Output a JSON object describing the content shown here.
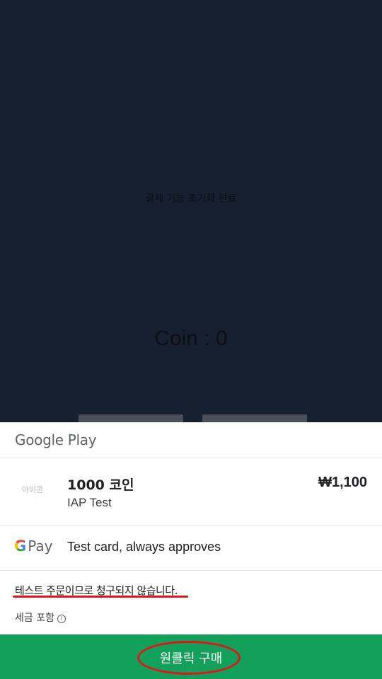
{
  "app": {
    "status_text": "결제 기능 초기화 완료",
    "coin_text": "Coin : 0"
  },
  "sheet": {
    "header": {
      "title": "Google Play"
    },
    "item": {
      "icon_placeholder": "아이콘",
      "title": "1000 코인",
      "subtitle": "IAP Test",
      "price": "₩1,100"
    },
    "payment": {
      "logo_g": "G",
      "logo_pay": "Pay",
      "method": "Test card, always approves"
    },
    "notice": "테스트 주문이므로 청구되지 않습니다.",
    "tax_label": "세금 포함",
    "info_icon": "i",
    "buy_button_label": "원클릭 구매"
  },
  "colors": {
    "app_background": "#17202f",
    "buy_button": "#13a05a",
    "annotation_red": "#e0161c"
  },
  "icons": [
    "google-pay-logo",
    "info-icon"
  ]
}
